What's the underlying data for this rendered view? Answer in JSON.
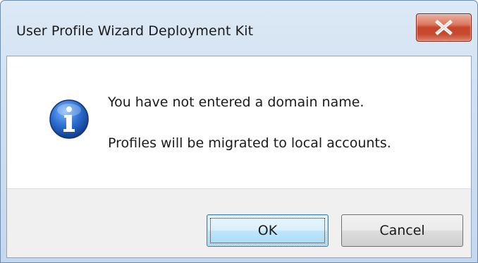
{
  "window": {
    "title": "User Profile Wizard Deployment Kit"
  },
  "titlebar": {
    "close_icon": "close-x-icon"
  },
  "message": {
    "icon": "information-icon",
    "line1": "You have not entered a domain name.",
    "line2": "Profiles will be migrated to local accounts."
  },
  "buttons": {
    "ok_label": "OK",
    "cancel_label": "Cancel"
  },
  "colors": {
    "close_button": "#c9462c",
    "info_icon": "#1f5fb8",
    "ok_button_border": "#3c7fb1"
  }
}
